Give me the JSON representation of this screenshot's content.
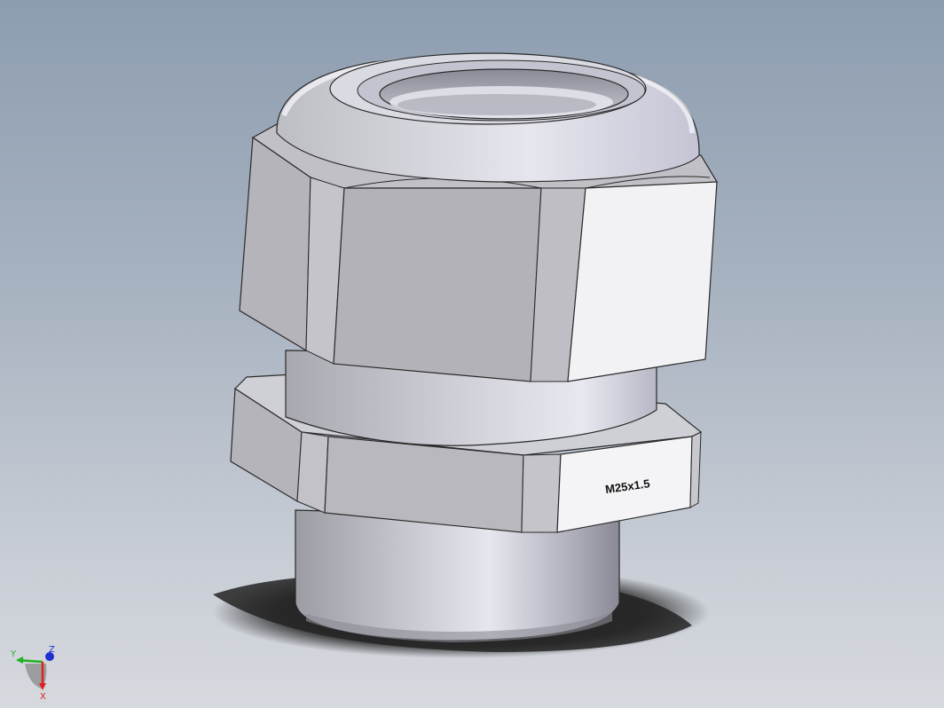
{
  "model": {
    "thread_label": "M25x1.5"
  },
  "triad": {
    "x_label": "X",
    "y_label": "Y",
    "z_label": "Z",
    "x_color": "#e02020",
    "y_color": "#20b020",
    "z_color": "#2030d0"
  },
  "colors": {
    "background_top": "#8d9db0",
    "background_bottom": "#d6d9de",
    "part_face": "#b6b6bc",
    "part_highlight": "#e8e8ee",
    "part_shadow": "#7a7a82"
  }
}
